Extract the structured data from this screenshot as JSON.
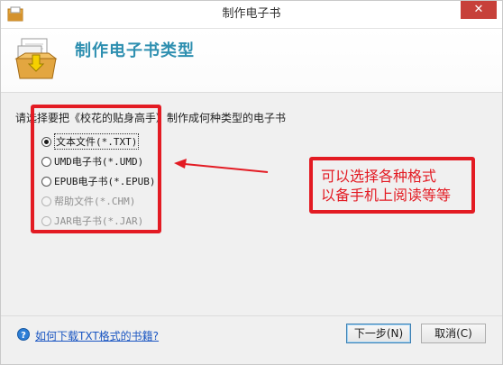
{
  "window": {
    "title": "制作电子书"
  },
  "titlebar": {
    "close_label": "✕"
  },
  "header": {
    "title": "制作电子书类型",
    "icon": "box-folder-icon"
  },
  "prompt": "请选择要把《校花的贴身高手》制作成何种类型的电子书",
  "options": [
    {
      "label": "文本文件(*.TXT)",
      "checked": true,
      "enabled": true
    },
    {
      "label": "UMD电子书(*.UMD)",
      "checked": false,
      "enabled": true
    },
    {
      "label": "EPUB电子书(*.EPUB)",
      "checked": false,
      "enabled": true
    },
    {
      "label": "帮助文件(*.CHM)",
      "checked": false,
      "enabled": false
    },
    {
      "label": "JAR电子书(*.JAR)",
      "checked": false,
      "enabled": false
    }
  ],
  "annotation": {
    "line1": "可以选择各种格式",
    "line2": "以备手机上阅读等等",
    "color": "#e31b23"
  },
  "footer": {
    "help_link": "如何下载TXT格式的书籍?",
    "next_label": "下一步(N)",
    "cancel_label": "取消(C)"
  }
}
